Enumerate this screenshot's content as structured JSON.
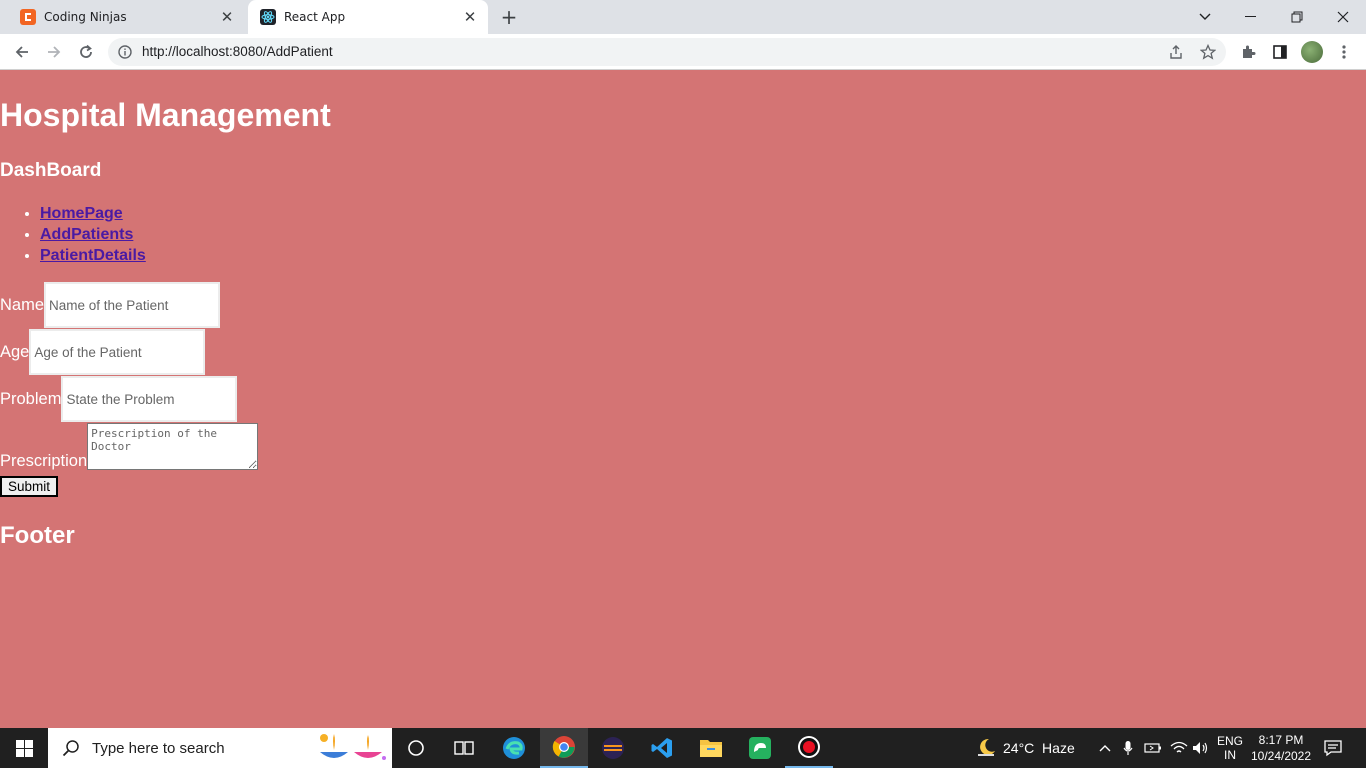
{
  "browser": {
    "tabs": [
      {
        "title": "Coding Ninjas",
        "favicon": "coding-ninjas-logo",
        "active": false
      },
      {
        "title": "React App",
        "favicon": "react-logo",
        "active": true
      }
    ],
    "url": "http://localhost:8080/AddPatient"
  },
  "page": {
    "title": "Hospital Management",
    "dashboard_heading": "DashBoard",
    "nav_links": [
      "HomePage",
      "AddPatients",
      "PatientDetails"
    ],
    "form": {
      "name_label": "Name",
      "name_placeholder": "Name of the Patient",
      "age_label": "Age",
      "age_placeholder": "Age of the Patient",
      "problem_label": "Problem",
      "problem_placeholder": "State the Problem",
      "prescription_label": "Prescription",
      "prescription_placeholder": "Prescription of the Doctor",
      "submit_label": "Submit"
    },
    "footer": "Footer",
    "colors": {
      "background": "#d47474",
      "link": "#4a1aa3"
    }
  },
  "taskbar": {
    "search_placeholder": "Type here to search",
    "weather": "24°C  Haze",
    "language_line1": "ENG",
    "language_line2": "IN",
    "time": "8:17 PM",
    "date": "10/24/2022"
  }
}
